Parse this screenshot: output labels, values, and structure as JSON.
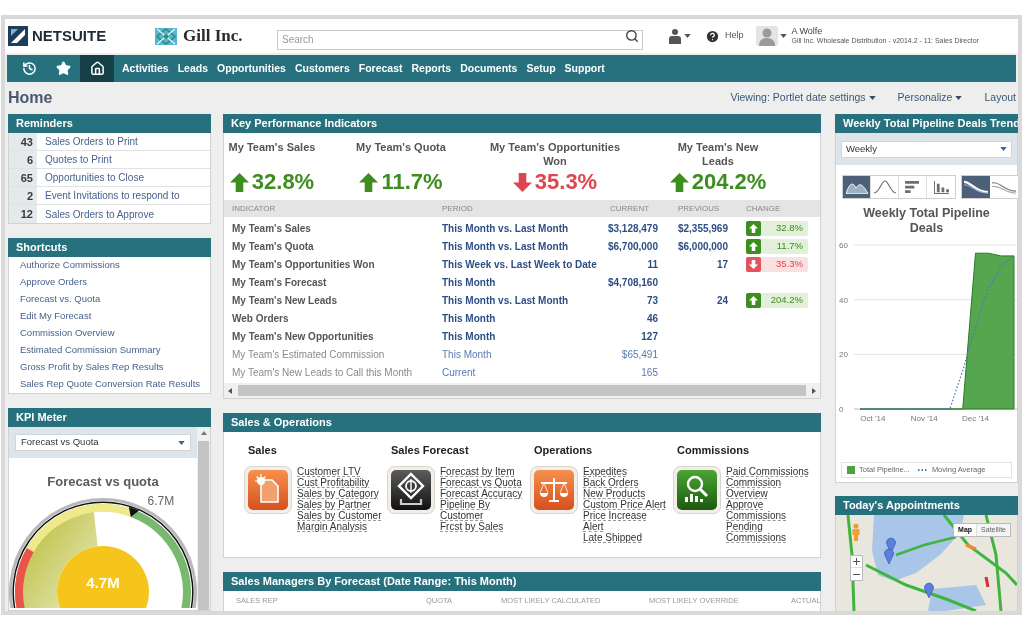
{
  "header": {
    "brand": "NETSUITE",
    "company": "Gill Inc.",
    "search": {
      "placeholder": "Search"
    },
    "help": "Help",
    "user": {
      "name": "A Wolfe",
      "detail": "Gill Inc. Wholesale Distribution - v2014.2 - 11: Sales Director"
    }
  },
  "nav": {
    "icons": [
      {
        "kind": "recent",
        "selected": false
      },
      {
        "kind": "favorites",
        "selected": false
      },
      {
        "kind": "home",
        "selected": true
      }
    ],
    "items": [
      {
        "label": "Activities",
        "selected": false
      },
      {
        "label": "Leads",
        "selected": false
      },
      {
        "label": "Opportunities",
        "selected": false
      },
      {
        "label": "Customers",
        "selected": false
      },
      {
        "label": "Forecast",
        "selected": false
      },
      {
        "label": "Reports",
        "selected": false
      },
      {
        "label": "Documents",
        "selected": false
      },
      {
        "label": "Setup",
        "selected": false
      },
      {
        "label": "Support",
        "selected": false
      }
    ]
  },
  "page": {
    "title": "Home",
    "actions": [
      {
        "label": "Viewing: Portlet date settings",
        "dropdown": true
      },
      {
        "label": "Personalize",
        "dropdown": true
      },
      {
        "label": "Layout",
        "dropdown": false
      }
    ]
  },
  "reminders": {
    "title": "Reminders",
    "items": [
      {
        "count": "43",
        "label": "Sales Orders to Print"
      },
      {
        "count": "6",
        "label": "Quotes to Print"
      },
      {
        "count": "65",
        "label": "Opportunities to Close"
      },
      {
        "count": "2",
        "label": "Event Invitations to respond to"
      },
      {
        "count": "12",
        "label": "Sales Orders to Approve"
      }
    ]
  },
  "shortcuts": {
    "title": "Shortcuts",
    "items": [
      "Authorize Commissions",
      "Approve Orders",
      "Forecast vs. Quota",
      "Edit My Forecast",
      "Commission Overview",
      "Estimated Commission Summary",
      "Gross Profit by Sales Rep Results",
      "Sales Rep Quote Conversion Rate Results"
    ]
  },
  "kpi_meter": {
    "title": "KPI Meter",
    "select": {
      "value": "Forecast vs Quota"
    },
    "gauge": {
      "title": "Forecast vs quota",
      "value": "4.7M",
      "level": 0.47,
      "target": {
        "label": "6.7M",
        "level": 0.67
      }
    }
  },
  "kpi": {
    "title": "Key Performance Indicators",
    "summary": [
      {
        "label": "My Team's Sales",
        "value": "32.8%",
        "kind": "up"
      },
      {
        "label": "My Team's Quota",
        "value": "11.7%",
        "kind": "up"
      },
      {
        "label": "My Team's Opportunities Won",
        "value": "35.3%",
        "kind": "down"
      },
      {
        "label": "My Team's New Leads",
        "value": "204.2%",
        "kind": "up"
      }
    ],
    "columns": [
      "INDICATOR",
      "PERIOD",
      "CURRENT",
      "PREVIOUS",
      "CHANGE"
    ],
    "rows": [
      {
        "bold": true,
        "indicator": "My Team's Sales",
        "period": "This Month vs. Last Month",
        "current": "$3,128,479",
        "previous": "$2,355,969",
        "change": {
          "value": "32.8%",
          "kind": "up"
        }
      },
      {
        "bold": true,
        "indicator": "My Team's Quota",
        "period": "This Month vs. Last Month",
        "current": "$6,700,000",
        "previous": "$6,000,000",
        "change": {
          "value": "11.7%",
          "kind": "up"
        }
      },
      {
        "bold": true,
        "indicator": "My Team's Opportunities Won",
        "period": "This Week vs. Last Week to Date",
        "current": "11",
        "previous": "17",
        "change": {
          "value": "35.3%",
          "kind": "down"
        }
      },
      {
        "bold": true,
        "indicator": "My Team's Forecast",
        "period": "This Month",
        "current": "$4,708,160"
      },
      {
        "bold": true,
        "indicator": "My Team's New Leads",
        "period": "This Month vs. Last Month",
        "current": "73",
        "previous": "24",
        "change": {
          "value": "204.2%",
          "kind": "up"
        }
      },
      {
        "bold": true,
        "indicator": "Web Orders",
        "period": "This Month",
        "current": "46"
      },
      {
        "bold": true,
        "indicator": "My Team's New Opportunities",
        "period": "This Month",
        "current": "127"
      },
      {
        "bold": false,
        "indicator": "My Team's Estimated Commission",
        "period": "This Month",
        "current": "$65,491"
      },
      {
        "bold": false,
        "indicator": "My Team's New Leads to Call this Month",
        "period": "Current",
        "current": "165"
      }
    ]
  },
  "sales_operations": {
    "title": "Sales & Operations",
    "groups": [
      {
        "title": "Sales",
        "kind": "document",
        "links": [
          "Customer LTV",
          "Cust Profitability",
          "Sales by Category",
          "Sales by Partner",
          "Sales by Customer",
          "Margin Analysis"
        ]
      },
      {
        "title": "Sales Forecast",
        "kind": "forecast",
        "links": [
          "Forecast by Item",
          "Forecast vs Quota",
          "Forecast Accuracy",
          "Pipeline By Customer",
          "Frcst by Sales"
        ]
      },
      {
        "title": "Operations",
        "kind": "scale",
        "links": [
          "Expedites",
          "Back Orders",
          "New Products",
          "Custom Price Alert",
          "Price Increase Alert",
          "Late Shipped"
        ]
      },
      {
        "title": "Commissions",
        "kind": "chart",
        "links": [
          "Paid Commissions",
          "Commission Overview",
          "Approve Commissions",
          "Pending Commissions"
        ]
      }
    ]
  },
  "sales_managers": {
    "title": "Sales Managers By Forecast (Date Range: This Month)",
    "columns": [
      "SALES REP",
      "QUOTA",
      "MOST LIKELY CALCULATED",
      "MOST LIKELY OVERRIDE",
      "ACTUAL"
    ]
  },
  "pipeline": {
    "title": "Weekly Total Pipeline Deals Trend",
    "select": {
      "value": "Weekly"
    },
    "chart_types": [
      {
        "kind": "area",
        "selected": true
      },
      {
        "kind": "line",
        "selected": false
      },
      {
        "kind": "bar",
        "selected": false
      },
      {
        "kind": "column",
        "selected": false
      }
    ],
    "curve_styles": [
      {
        "kind": "filled",
        "selected": true
      },
      {
        "kind": "lines",
        "selected": false
      }
    ],
    "chart_data": {
      "type": "area",
      "title": "Weekly Total Pipeline Deals",
      "categories": [
        null,
        "Oct '14",
        null,
        null,
        null,
        "Nov '14",
        null,
        null,
        null,
        "Dec '14",
        null,
        null,
        null
      ],
      "ylim": [
        0,
        60
      ],
      "yticks": [
        0,
        20,
        40,
        60
      ],
      "legend": true,
      "series": [
        {
          "name": "Total Pipeline...",
          "color": "#4ca144",
          "values": [
            0,
            0,
            0,
            0,
            0,
            0,
            0,
            0,
            0,
            57,
            57,
            56,
            56
          ]
        },
        {
          "name": "Moving Average",
          "type": "line",
          "line_style": "dotted",
          "color": "#4a78c2",
          "values": [
            0,
            0,
            0,
            0,
            0,
            0,
            0,
            0,
            14,
            30,
            44,
            52,
            56
          ]
        }
      ]
    }
  },
  "appointments": {
    "title": "Today's Appointments",
    "map_types": [
      {
        "label": "Map",
        "selected": true
      },
      {
        "label": "Satellite",
        "selected": false
      }
    ]
  }
}
